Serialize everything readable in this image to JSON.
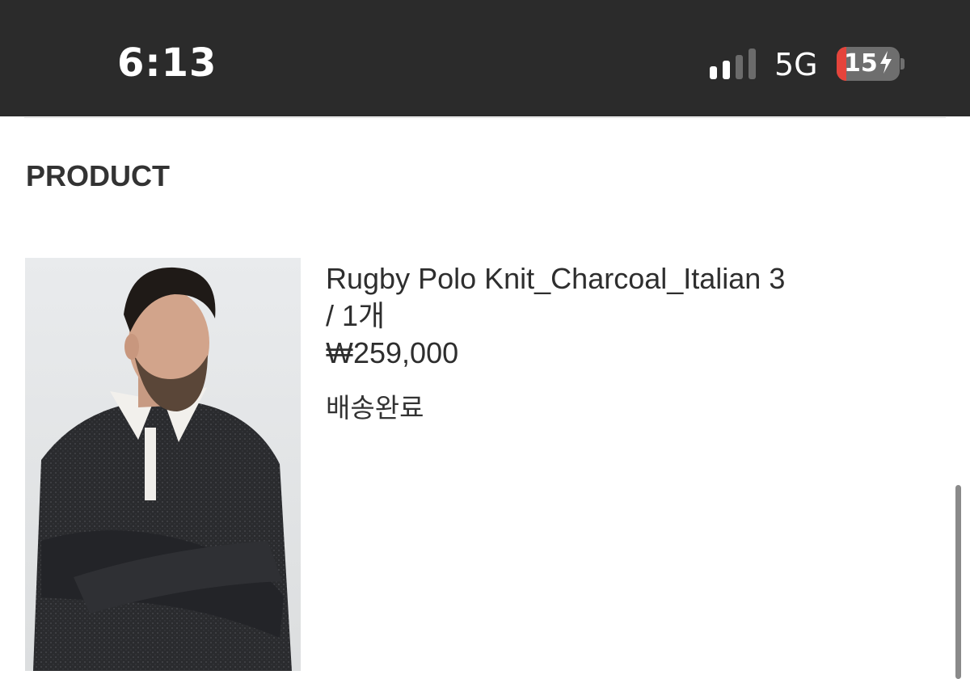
{
  "status_bar": {
    "time": "6:13",
    "network": "5G",
    "battery_level": "15",
    "battery_charging": true,
    "signal_bars_active": 2,
    "signal_bars_total": 4,
    "battery_fill_fraction": 0.15,
    "colors": {
      "background": "#2b2b2b",
      "battery_low": "#e5443b"
    }
  },
  "section": {
    "title": "PRODUCT"
  },
  "product": {
    "image_icon": "product-photo",
    "name_option": "Rugby Polo Knit_Charcoal_Italian 3",
    "quantity": "/ 1개",
    "price": "₩259,000",
    "status": "배송완료"
  }
}
